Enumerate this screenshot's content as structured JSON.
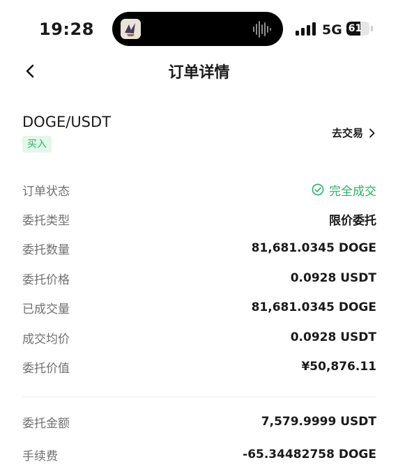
{
  "status_bar": {
    "time": "19:28",
    "network": "5G",
    "battery": 61
  },
  "nav": {
    "title": "订单详情"
  },
  "order": {
    "pair": "DOGE/USDT",
    "side": "买入",
    "trade_link": "去交易"
  },
  "details": [
    {
      "label": "订单状态",
      "value": "完全成交"
    },
    {
      "label": "委托类型",
      "value": "限价委托"
    },
    {
      "label": "委托数量",
      "value": "81,681.0345 DOGE"
    },
    {
      "label": "委托价格",
      "value": "0.0928 USDT"
    },
    {
      "label": "已成交量",
      "value": "81,681.0345 DOGE"
    },
    {
      "label": "成交均价",
      "value": "0.0928 USDT"
    },
    {
      "label": "委托价值",
      "value": "¥50,876.11"
    }
  ],
  "fees": [
    {
      "label": "委托金额",
      "value": "7,579.9999 USDT"
    },
    {
      "label": "手续费",
      "value": "-65.34482758 DOGE"
    }
  ],
  "colors": {
    "success": "#2bb365",
    "badge_bg": "#e3f6ea"
  },
  "icons": [
    "back-chevron-icon",
    "chevron-right-icon",
    "check-circle-icon",
    "waveform-icon",
    "signal-icon",
    "battery-icon"
  ]
}
